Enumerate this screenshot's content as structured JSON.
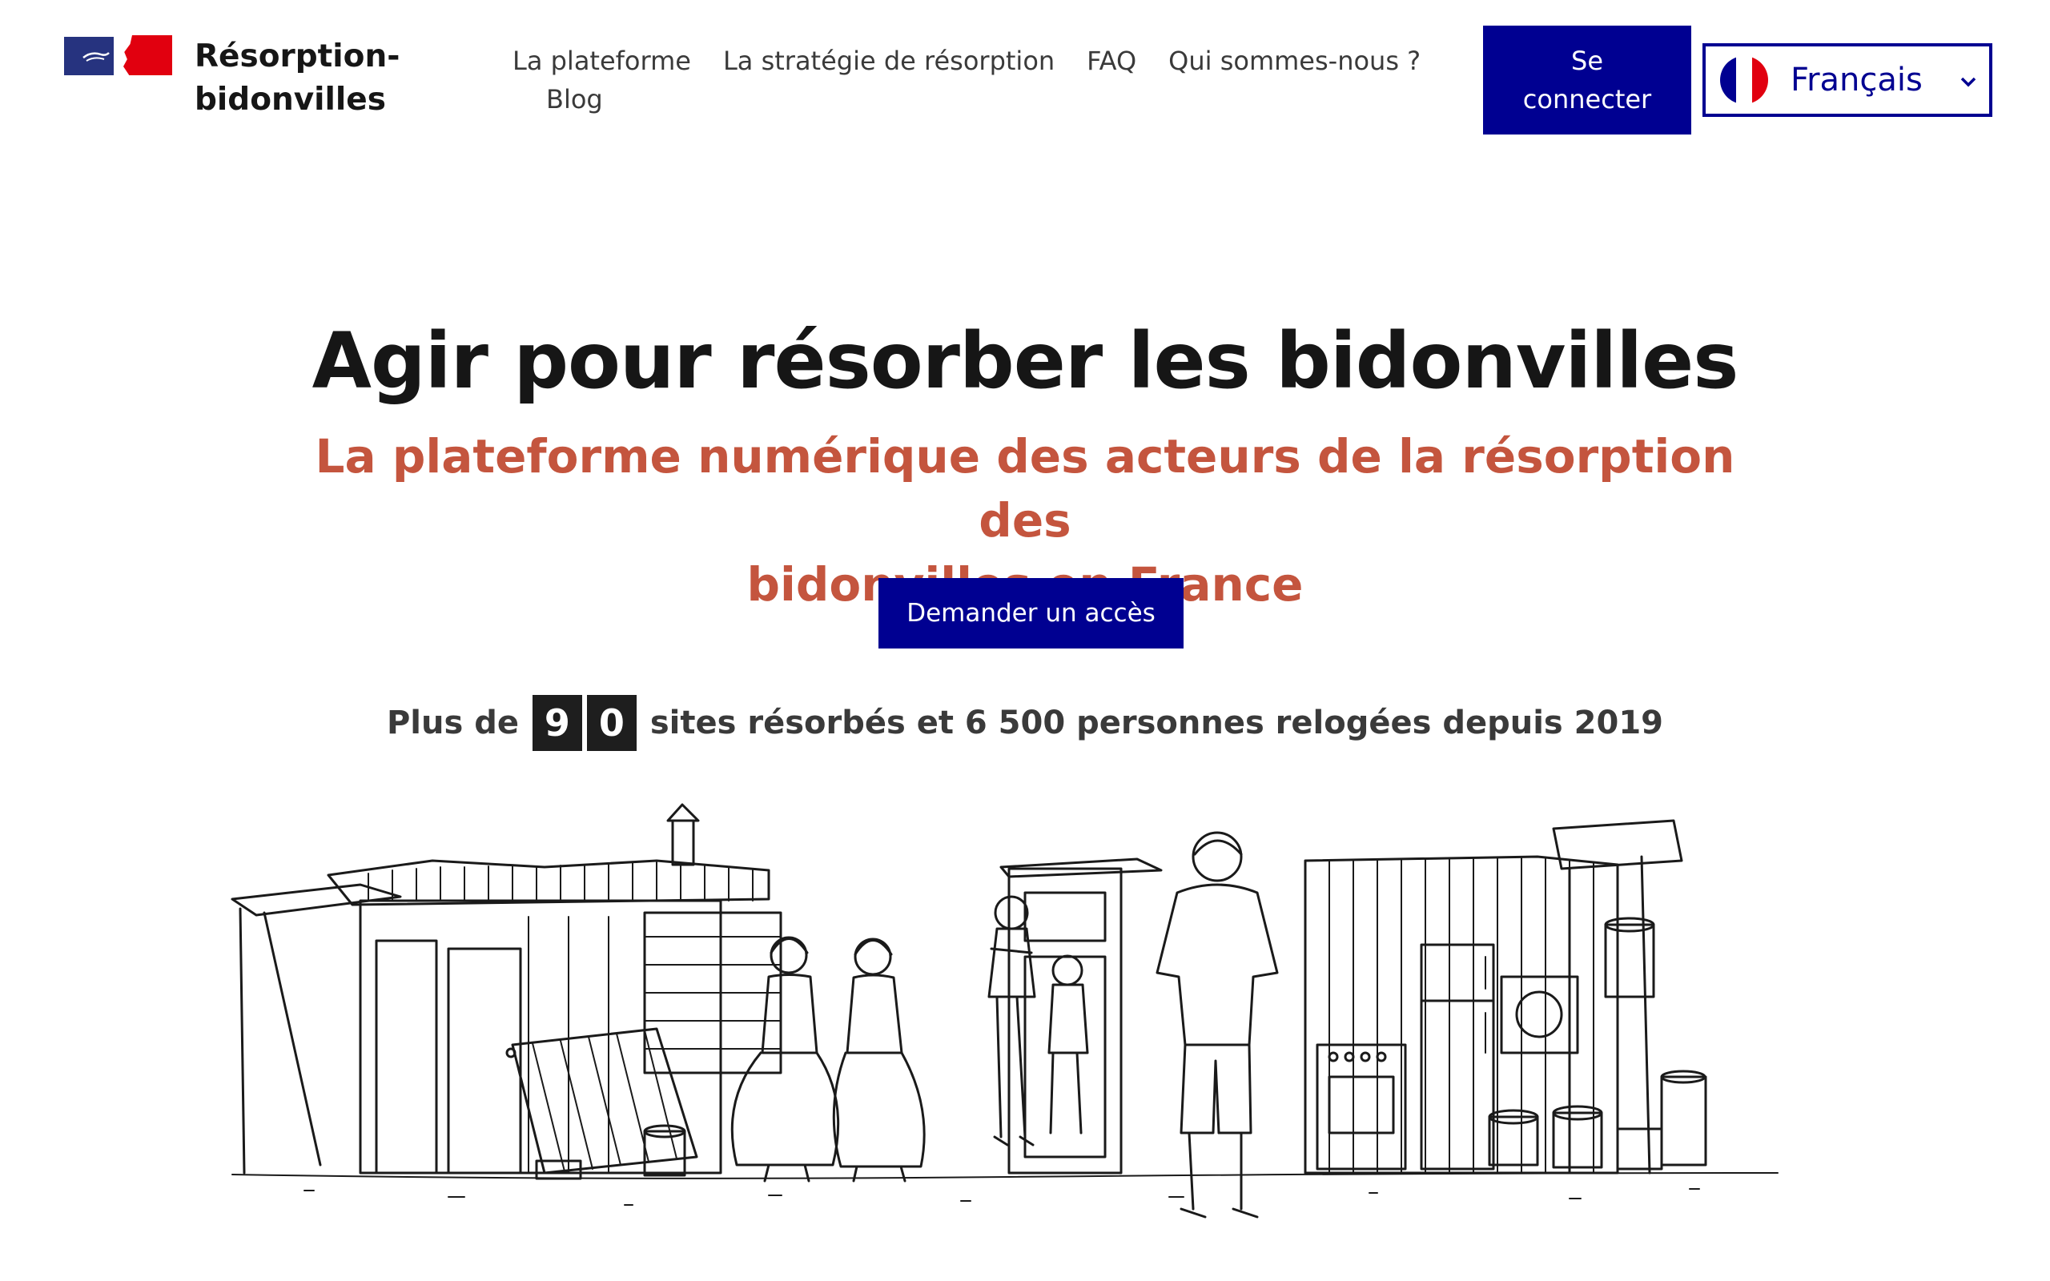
{
  "header": {
    "site_name_line1": "Résorption-",
    "site_name_line2": "bidonvilles",
    "nav": [
      {
        "label": "La plateforme"
      },
      {
        "label": "La stratégie de résorption"
      },
      {
        "label": "FAQ"
      },
      {
        "label": "Qui sommes-nous ?"
      },
      {
        "label": "Blog"
      }
    ],
    "login_line1": "Se",
    "login_line2": "connecter",
    "language": "Français"
  },
  "hero": {
    "title": "Agir pour résorber les bidonvilles",
    "subtitle_line1": "La plateforme numérique des acteurs de la résorption des",
    "subtitle_line2": "bidonvilles en France",
    "cta": "Demander un accès"
  },
  "stats": {
    "prefix": "Plus de",
    "digits": [
      "9",
      "0"
    ],
    "suffix": "sites résorbés et 6 500 personnes relogées depuis 2019"
  },
  "colors": {
    "primary": "#000091",
    "accent": "#c4553e",
    "flag_blue": "#26337f",
    "flag_red": "#e1000f"
  },
  "icons": {
    "logo": "marianne-logo",
    "flag": "france-flag-icon",
    "select_arrow": "chevron-down-icon"
  }
}
